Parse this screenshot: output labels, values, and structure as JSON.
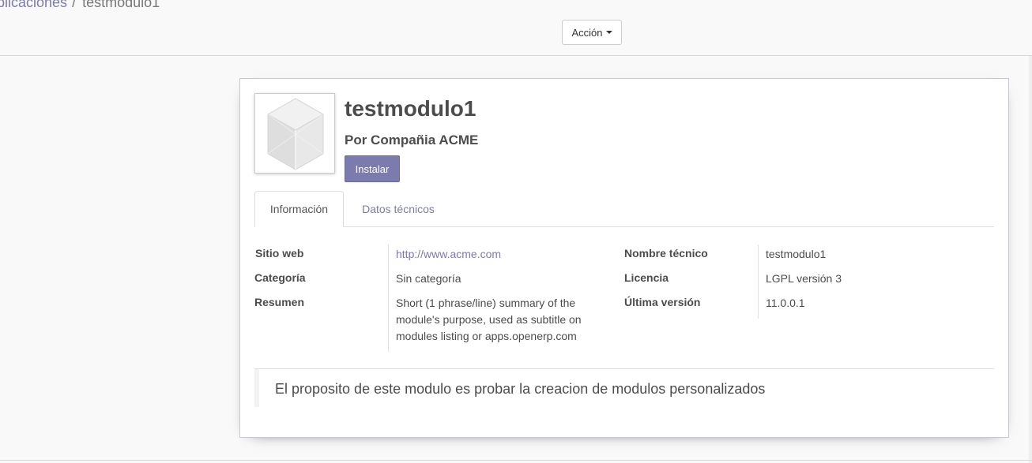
{
  "breadcrumb": {
    "parent": "plicaciones",
    "separator": "/",
    "current": "testmodulo1"
  },
  "toolbar": {
    "action_label": "Acción"
  },
  "module": {
    "name": "testmodulo1",
    "author": "Por Compañia ACME",
    "install_label": "Instalar",
    "icon": "cube-icon"
  },
  "tabs": [
    {
      "label": "Información",
      "active": true
    },
    {
      "label": "Datos técnicos",
      "active": false
    }
  ],
  "fields_left": [
    {
      "label": "Sitio web",
      "value": "http://www.acme.com"
    },
    {
      "label": "Categoría",
      "value": "Sin categoría"
    },
    {
      "label": "Resumen",
      "value_lines": [
        "Short (1 phrase/line) summary of the",
        "module's purpose, used as subtitle on",
        "modules listing or apps.openerp.com"
      ]
    }
  ],
  "fields_right": [
    {
      "label": "Nombre técnico",
      "value": "testmodulo1"
    },
    {
      "label": "Licencia",
      "value": "LGPL versión 3"
    },
    {
      "label": "Última versión",
      "value": "11.0.0.1"
    }
  ],
  "description": "El proposito de este modulo es probar la creacion de modulos personalizados",
  "colors": {
    "accent": "#7c7bad",
    "text": "#4c4c4c",
    "background": "#f9f9f9"
  }
}
